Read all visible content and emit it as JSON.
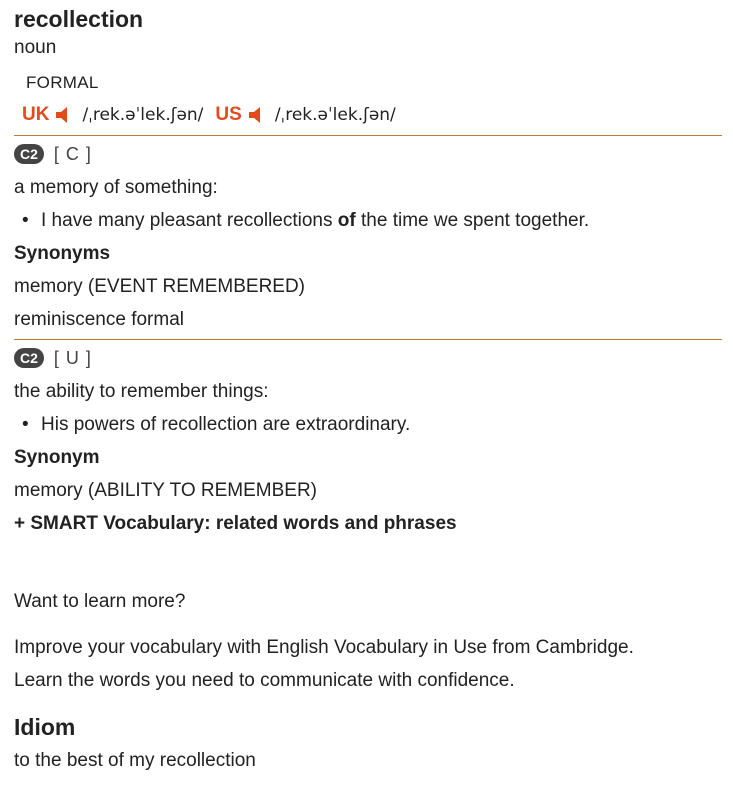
{
  "entry": {
    "headword": "recollection",
    "pos": "noun",
    "usage": "FORMAL",
    "pron": {
      "uk_label": "UK",
      "uk_ipa": "/ˌrek.əˈlek.ʃən/",
      "us_label": "US",
      "us_ipa": "/ˌrek.əˈlek.ʃən/",
      "speaker_icon": "speaker-icon",
      "accent_color": "#e14d1a"
    },
    "senses": [
      {
        "level": "C2",
        "grammar": "[ C ]",
        "definition": "a memory of something:",
        "example_pre": "I have many pleasant recollections ",
        "example_bold": "of",
        "example_post": " the time we spent together.",
        "syn_heading": "Synonyms",
        "synonyms": [
          "memory (EVENT REMEMBERED)",
          "reminiscence formal"
        ]
      },
      {
        "level": "C2",
        "grammar": "[ U ]",
        "definition": "the ability to remember things:",
        "example": "His powers of recollection are extraordinary.",
        "syn_heading": "Synonym",
        "synonyms": [
          "memory (ABILITY TO REMEMBER)"
        ]
      }
    ],
    "smart_vocab": "+ SMART Vocabulary: related words and phrases"
  },
  "promo": {
    "question": "Want to learn more?",
    "line1": "Improve your vocabulary with English Vocabulary in Use from Cambridge.",
    "line2": "Learn the words you need to communicate with confidence."
  },
  "idiom": {
    "heading": "Idiom",
    "text": "to the best of my recollection"
  }
}
